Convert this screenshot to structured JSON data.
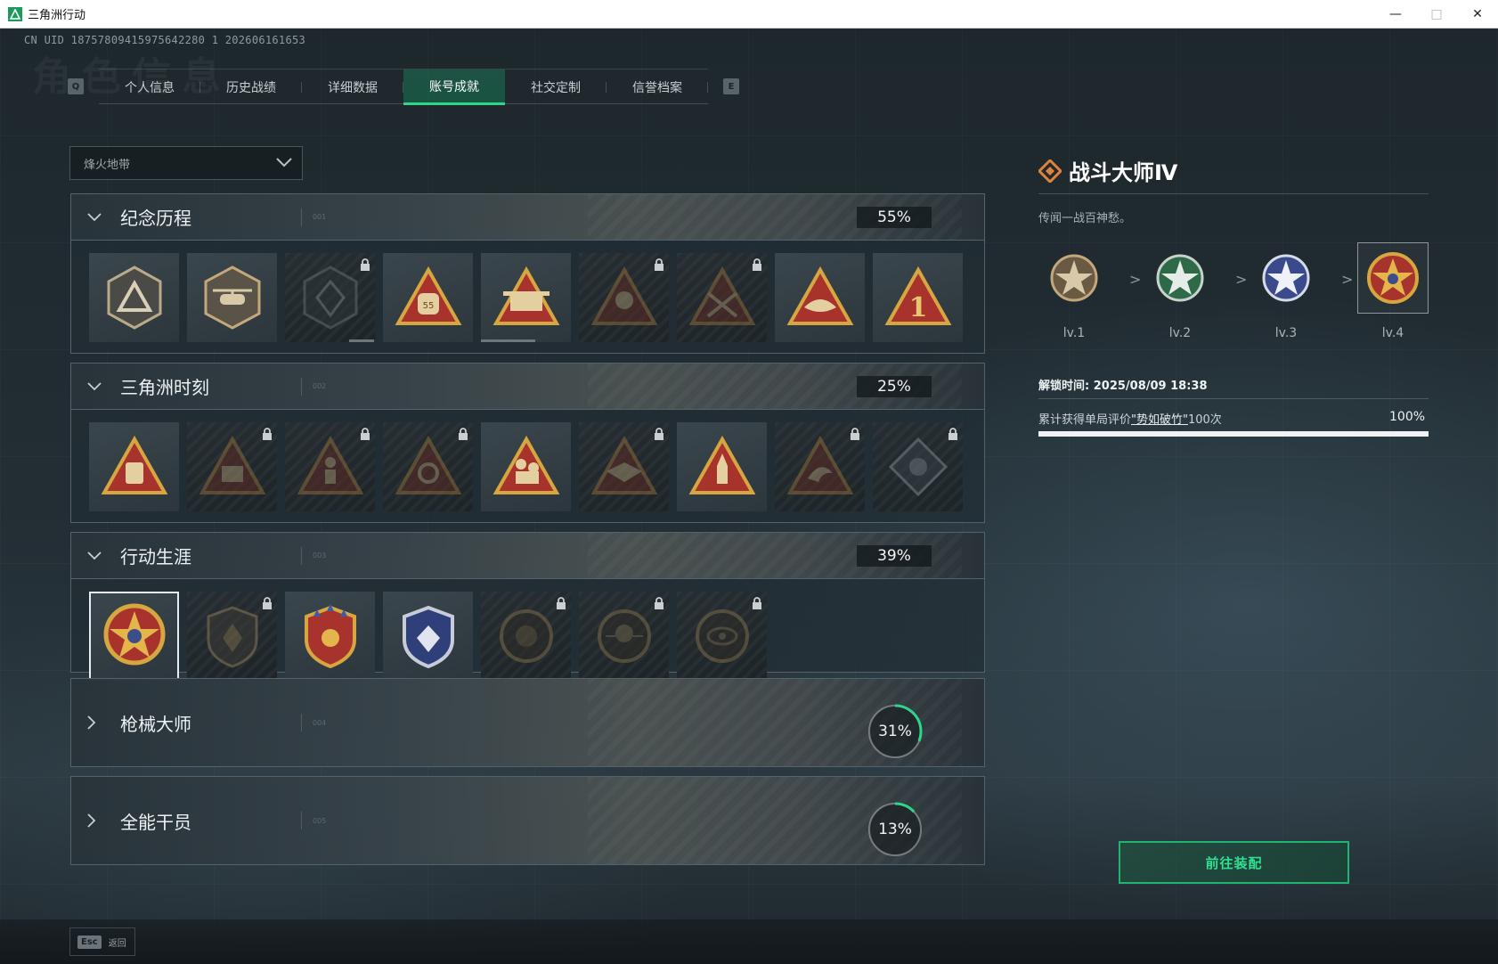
{
  "window": {
    "title": "三角洲行动"
  },
  "uid_text": "CN UID 18757809415975642280 1 202606161653",
  "background_heading": "角色信息",
  "tabs": {
    "prev_key": "Q",
    "next_key": "E",
    "items": [
      {
        "label": "个人信息",
        "active": false
      },
      {
        "label": "历史战绩",
        "active": false
      },
      {
        "label": "详细数据",
        "active": false
      },
      {
        "label": "账号成就",
        "active": true
      },
      {
        "label": "社交定制",
        "active": false
      },
      {
        "label": "信誉档案",
        "active": false
      }
    ]
  },
  "mode_select": {
    "value": "烽火地带"
  },
  "sections": [
    {
      "title": "纪念历程",
      "num": "001",
      "percent": "55%",
      "expanded": true
    },
    {
      "title": "三角洲时刻",
      "num": "002",
      "percent": "25%",
      "expanded": true
    },
    {
      "title": "行动生涯",
      "num": "003",
      "percent": "39%",
      "expanded": true
    },
    {
      "title": "枪械大师",
      "num": "004",
      "percent": "31%",
      "progress": 0.31,
      "expanded": false
    },
    {
      "title": "全能干员",
      "num": "005",
      "percent": "13%",
      "progress": 0.13,
      "expanded": false
    }
  ],
  "detail": {
    "name": "战斗大师Ⅳ",
    "description": "传闻一战百神愁。",
    "levels": [
      "lv.1",
      "lv.2",
      "lv.3",
      "lv.4"
    ],
    "arrow": ">",
    "unlock_time": "解锁时间: 2025/08/09 18:38",
    "requirement_prefix": "累计获得单局评价",
    "requirement_link": "\"势如破竹\"",
    "requirement_suffix": "100次",
    "requirement_percent": "100%",
    "requirement_progress": 1.0,
    "equip_button": "前往装配"
  },
  "bottom": {
    "esc_key": "Esc",
    "esc_label": "返回"
  },
  "colors": {
    "accent_green": "#2ed68c",
    "button_text": "#2fe08f",
    "gold": "#c99a3c",
    "red_badge": "#a8322c"
  }
}
